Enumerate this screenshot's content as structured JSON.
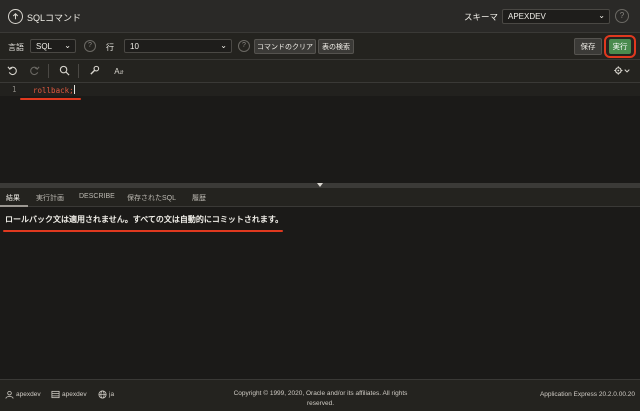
{
  "header": {
    "title": "SQLコマンド",
    "schema_label": "スキーマ",
    "schema_value": "APEXDEV"
  },
  "toolbar": {
    "language_label": "言語",
    "language_value": "SQL",
    "rows_label": "行",
    "rows_value": "10",
    "clear_command_label": "コマンドのクリア",
    "find_tables_label": "表の検索",
    "save_label": "保存",
    "run_label": "実行",
    "text_size_label": "A"
  },
  "editor": {
    "line_number": "1",
    "code": "rollback;"
  },
  "tabs": [
    {
      "label": "結果"
    },
    {
      "label": "実行計画"
    },
    {
      "label": "DESCRIBE"
    },
    {
      "label": "保存されたSQL"
    },
    {
      "label": "履歴"
    }
  ],
  "results": {
    "message": "ロールバック文は適用されません。すべての文は自動的にコミットされます。"
  },
  "footer": {
    "user": "apexdev",
    "workspace": "apexdev",
    "language": "ja",
    "copyright": "Copyright © 1999, 2020, Oracle and/or its affiliates. All rights reserved.",
    "version": "Application Express 20.2.0.00.20"
  },
  "colors": {
    "accent_red": "#e0391f",
    "run_green": "#4a8b4e",
    "code_keyword": "#e0593f"
  }
}
